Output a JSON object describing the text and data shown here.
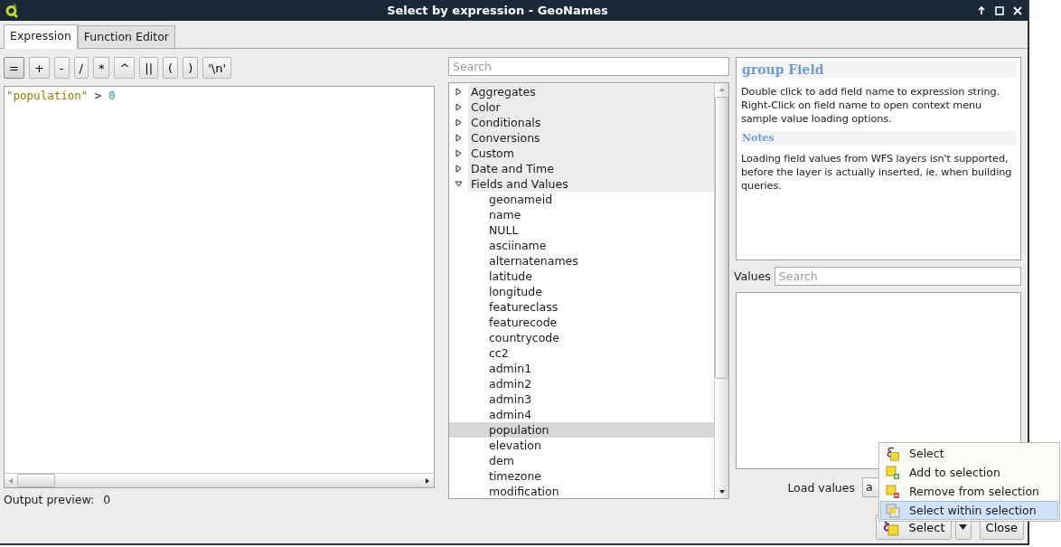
{
  "window": {
    "title": "Select by expression - GeoNames"
  },
  "tabs": [
    {
      "label": "Expression",
      "selected": true
    },
    {
      "label": "Function Editor",
      "selected": false
    }
  ],
  "operator_buttons": [
    "=",
    "+",
    "-",
    "/",
    "*",
    "^",
    "||",
    "(",
    ")",
    "'\\n'"
  ],
  "expression": {
    "tokens": [
      {
        "kind": "field",
        "text": "\"population\""
      },
      {
        "kind": "operator",
        "text": ">"
      },
      {
        "kind": "number",
        "text": "0"
      }
    ]
  },
  "output_preview": {
    "label": "Output preview:",
    "value": "0"
  },
  "function_search": {
    "placeholder": "Search"
  },
  "function_tree": [
    {
      "label": "Aggregates",
      "expanded": false
    },
    {
      "label": "Color",
      "expanded": false
    },
    {
      "label": "Conditionals",
      "expanded": false
    },
    {
      "label": "Conversions",
      "expanded": false
    },
    {
      "label": "Custom",
      "expanded": false
    },
    {
      "label": "Date and Time",
      "expanded": false
    },
    {
      "label": "Fields and Values",
      "expanded": true,
      "children": [
        {
          "label": "geonameid",
          "selected": false
        },
        {
          "label": "name",
          "selected": false
        },
        {
          "label": "NULL",
          "selected": false
        },
        {
          "label": "asciiname",
          "selected": false
        },
        {
          "label": "alternatenames",
          "selected": false
        },
        {
          "label": "latitude",
          "selected": false
        },
        {
          "label": "longitude",
          "selected": false
        },
        {
          "label": "featureclass",
          "selected": false
        },
        {
          "label": "featurecode",
          "selected": false
        },
        {
          "label": "countrycode",
          "selected": false
        },
        {
          "label": "cc2",
          "selected": false
        },
        {
          "label": "admin1",
          "selected": false
        },
        {
          "label": "admin2",
          "selected": false
        },
        {
          "label": "admin3",
          "selected": false
        },
        {
          "label": "admin4",
          "selected": false
        },
        {
          "label": "population",
          "selected": true
        },
        {
          "label": "elevation",
          "selected": false
        },
        {
          "label": "dem",
          "selected": false
        },
        {
          "label": "timezone",
          "selected": false
        },
        {
          "label": "modification",
          "selected": false
        }
      ]
    }
  ],
  "help": {
    "title": "group Field",
    "text": "Double click to add field name to expression string. Right-Click on field name to open context menu sample value loading options.",
    "notes_title": "Notes",
    "notes_text": "Loading field values from WFS layers isn't supported, before the layer is actually inserted, ie. when building queries."
  },
  "values": {
    "label": "Values",
    "placeholder": "Search"
  },
  "load_values": {
    "label": "Load values",
    "value": "a"
  },
  "select_menu": [
    {
      "kind": "select",
      "label": "Select",
      "selected": false
    },
    {
      "kind": "add",
      "label": "Add to selection",
      "selected": false
    },
    {
      "kind": "remove",
      "label": "Remove from selection",
      "selected": false
    },
    {
      "kind": "within",
      "label": "Select within selection",
      "selected": true
    }
  ],
  "buttons": {
    "select": "Select",
    "close": "Close"
  }
}
